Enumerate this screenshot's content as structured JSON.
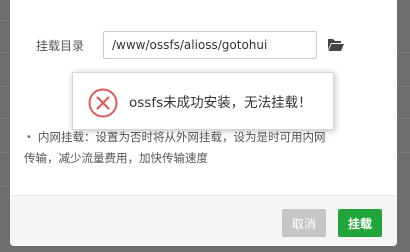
{
  "form": {
    "mount_dir_label": "挂载目录",
    "mount_dir_value": "/www/ossfs/alioss/gotohui",
    "folder_icon": "folder-open-icon"
  },
  "info": {
    "bullet": "•",
    "line1": "内网挂载：设置为否时将从外网挂载，设为是时可用内网",
    "line2": "传输，减少流量费用，加快传输速度"
  },
  "toast": {
    "icon": "error-circle-x-icon",
    "message": "ossfs未成功安装，无法挂载！",
    "icon_color": "#e05a5a"
  },
  "footer": {
    "cancel_label": "取消",
    "mount_label": "挂载"
  },
  "colors": {
    "primary": "#20a53a",
    "disabled": "#c6c6c6",
    "error": "#e05a5a"
  }
}
